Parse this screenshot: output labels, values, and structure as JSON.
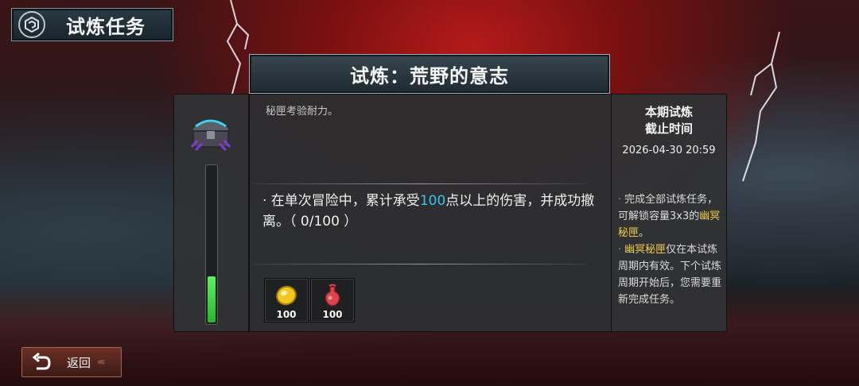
{
  "header": {
    "title": "试炼任务"
  },
  "trial": {
    "title": "试炼：荒野的意志",
    "description": "秘匣考验耐力。",
    "task": {
      "prefix": "· 在单次冒险中，累计承受",
      "highlight": "100",
      "suffix": "点以上的伤害，并成功撤离。",
      "progress_text": "（ 0/100 ）"
    },
    "chest_progress_percent": 30,
    "rewards": [
      {
        "icon": "gold-coin-icon",
        "amount": "100"
      },
      {
        "icon": "red-potion-icon",
        "amount": "100"
      }
    ]
  },
  "deadline": {
    "title_line1": "本期试炼",
    "title_line2": "截止时间",
    "time": "2026-04-30 20:59",
    "notes": [
      {
        "bullet": "·",
        "text_before": "完成全部试炼任务，可解锁容量3x3的",
        "highlight": "幽冥秘匣",
        "text_after": "。"
      },
      {
        "bullet": "·",
        "text_before": "",
        "highlight": "幽冥秘匣",
        "text_after": "仅在本试炼周期内有效。下个试炼周期开始后，您需要重新完成任务。"
      }
    ]
  },
  "back_button": {
    "label": "返回"
  },
  "colors": {
    "highlight_cyan": "#36c6e6",
    "highlight_yellow": "#f2c94c",
    "progress_green": "#3ad63c"
  }
}
